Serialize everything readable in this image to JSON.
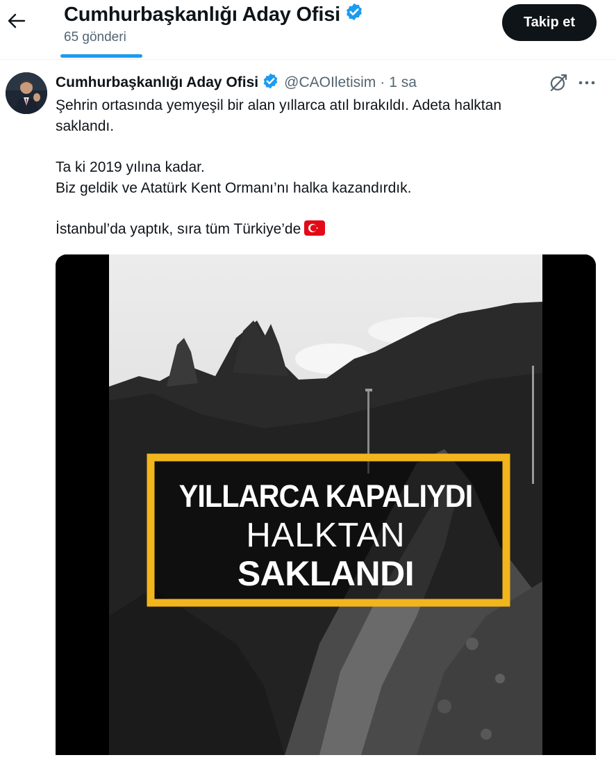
{
  "header": {
    "profile_name": "Cumhurbaşkanlığı Aday Ofisi",
    "post_count": "65 gönderi",
    "follow_label": "Takip et",
    "back_icon": "arrow-left-icon",
    "verified_icon": "verified-badge-icon"
  },
  "tweet": {
    "author_name": "Cumhurbaşkanlığı Aday Ofisi",
    "handle": "@CAOIletisim",
    "separator": "·",
    "time": "1 sa",
    "text_line1": "Şehrin ortasında yemyeşil bir alan yıllarca atıl bırakıldı. Adeta halktan",
    "text_line2": "saklandı.",
    "text_line3": "Ta ki 2019 yılına kadar.",
    "text_line4": "Biz geldik ve Atatürk Kent Ormanı’nı halka kazandırdık.",
    "text_line5": "İstanbul’da yaptık, sıra tüm Türkiye’de",
    "flag_icon": "turkey-flag-icon",
    "grok_icon": "grok-icon",
    "more_icon": "more-horizontal-icon"
  },
  "media": {
    "overlay_line1": "YILLARCA KAPALIYDI",
    "overlay_line2": "HALKTAN",
    "overlay_line3": "SAKLANDI",
    "frame_color": "#f2b51d"
  },
  "colors": {
    "accent": "#1d9bf0",
    "text_primary": "#0f1419",
    "text_secondary": "#536471",
    "button_dark": "#0f1419"
  }
}
